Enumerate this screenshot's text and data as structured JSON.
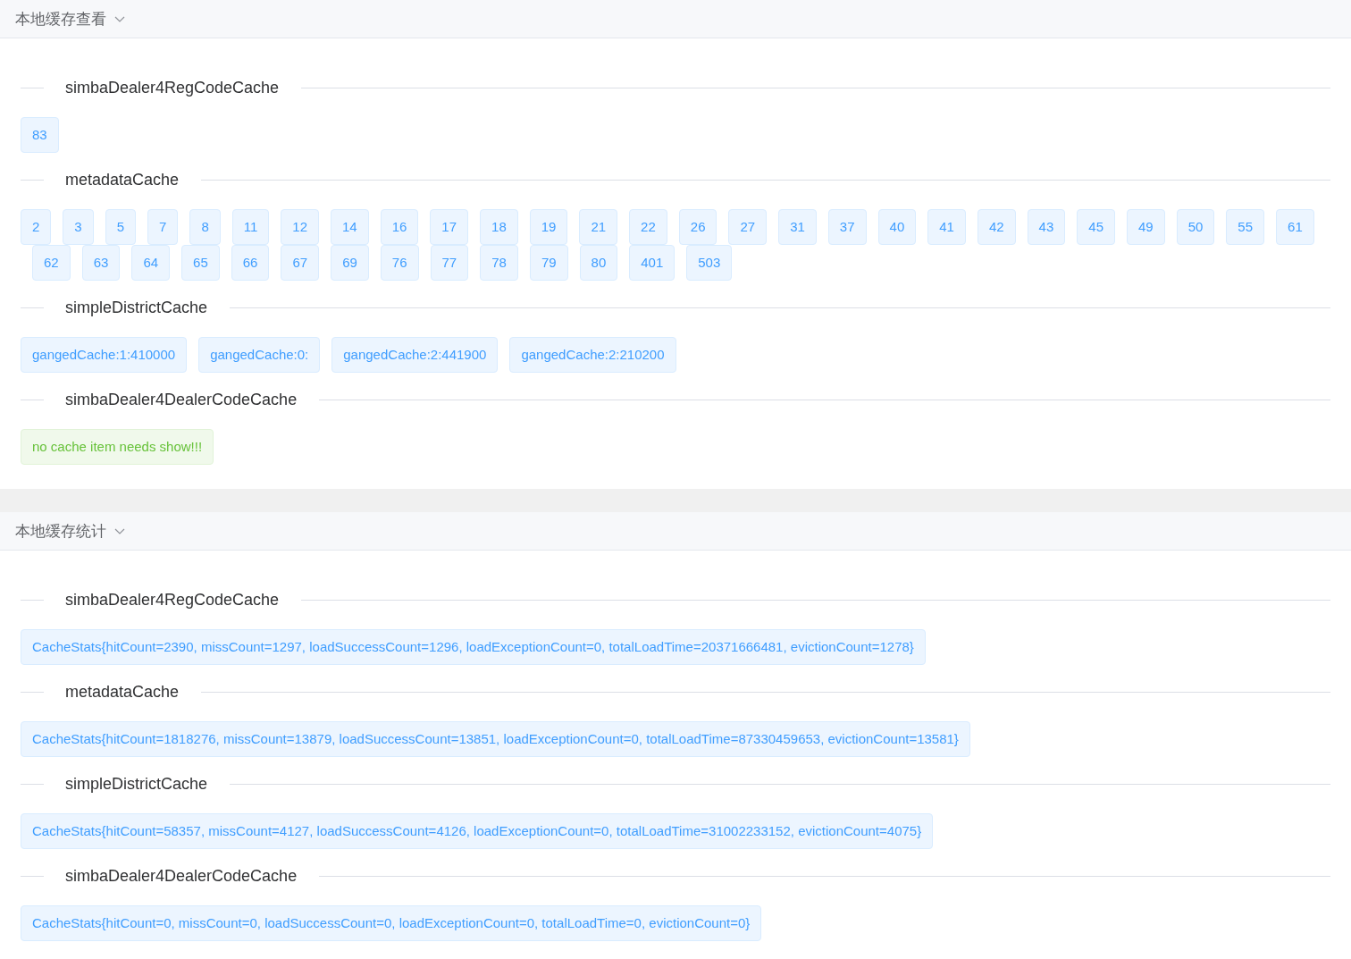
{
  "panels": [
    {
      "title": "本地缓存查看",
      "expanded": true,
      "sections": [
        {
          "name": "simbaDealer4RegCodeCache",
          "tags": [
            {
              "kind": "info",
              "text": "83"
            }
          ]
        },
        {
          "name": "metadataCache",
          "tags": [
            {
              "kind": "info",
              "text": "2"
            },
            {
              "kind": "info",
              "text": "3"
            },
            {
              "kind": "info",
              "text": "5"
            },
            {
              "kind": "info",
              "text": "7"
            },
            {
              "kind": "info",
              "text": "8"
            },
            {
              "kind": "info",
              "text": "11"
            },
            {
              "kind": "info",
              "text": "12"
            },
            {
              "kind": "info",
              "text": "14"
            },
            {
              "kind": "info",
              "text": "16"
            },
            {
              "kind": "info",
              "text": "17"
            },
            {
              "kind": "info",
              "text": "18"
            },
            {
              "kind": "info",
              "text": "19"
            },
            {
              "kind": "info",
              "text": "21"
            },
            {
              "kind": "info",
              "text": "22"
            },
            {
              "kind": "info",
              "text": "26"
            },
            {
              "kind": "info",
              "text": "27"
            },
            {
              "kind": "info",
              "text": "31"
            },
            {
              "kind": "info",
              "text": "37"
            },
            {
              "kind": "info",
              "text": "40"
            },
            {
              "kind": "info",
              "text": "41"
            },
            {
              "kind": "info",
              "text": "42"
            },
            {
              "kind": "info",
              "text": "43"
            },
            {
              "kind": "info",
              "text": "45"
            },
            {
              "kind": "info",
              "text": "49"
            },
            {
              "kind": "info",
              "text": "50"
            },
            {
              "kind": "info",
              "text": "55"
            },
            {
              "kind": "info",
              "text": "61"
            },
            {
              "kind": "info",
              "text": "62"
            },
            {
              "kind": "info",
              "text": "63"
            },
            {
              "kind": "info",
              "text": "64"
            },
            {
              "kind": "info",
              "text": "65"
            },
            {
              "kind": "info",
              "text": "66"
            },
            {
              "kind": "info",
              "text": "67"
            },
            {
              "kind": "info",
              "text": "69"
            },
            {
              "kind": "info",
              "text": "76"
            },
            {
              "kind": "info",
              "text": "77"
            },
            {
              "kind": "info",
              "text": "78"
            },
            {
              "kind": "info",
              "text": "79"
            },
            {
              "kind": "info",
              "text": "80"
            },
            {
              "kind": "info",
              "text": "401"
            },
            {
              "kind": "info",
              "text": "503"
            }
          ]
        },
        {
          "name": "simpleDistrictCache",
          "tags": [
            {
              "kind": "info",
              "text": "gangedCache:1:410000"
            },
            {
              "kind": "info",
              "text": "gangedCache:0:"
            },
            {
              "kind": "info",
              "text": "gangedCache:2:441900"
            },
            {
              "kind": "info",
              "text": "gangedCache:2:210200"
            }
          ]
        },
        {
          "name": "simbaDealer4DealerCodeCache",
          "tags": [
            {
              "kind": "success",
              "text": "no cache item needs show!!!"
            }
          ]
        }
      ]
    },
    {
      "title": "本地缓存统计",
      "expanded": true,
      "sections": [
        {
          "name": "simbaDealer4RegCodeCache",
          "tags": [
            {
              "kind": "info",
              "text": "CacheStats{hitCount=2390, missCount=1297, loadSuccessCount=1296, loadExceptionCount=0, totalLoadTime=20371666481, evictionCount=1278}"
            }
          ]
        },
        {
          "name": "metadataCache",
          "tags": [
            {
              "kind": "info",
              "text": "CacheStats{hitCount=1818276, missCount=13879, loadSuccessCount=13851, loadExceptionCount=0, totalLoadTime=87330459653, evictionCount=13581}"
            }
          ]
        },
        {
          "name": "simpleDistrictCache",
          "tags": [
            {
              "kind": "info",
              "text": "CacheStats{hitCount=58357, missCount=4127, loadSuccessCount=4126, loadExceptionCount=0, totalLoadTime=31002233152, evictionCount=4075}"
            }
          ]
        },
        {
          "name": "simbaDealer4DealerCodeCache",
          "tags": [
            {
              "kind": "info",
              "text": "CacheStats{hitCount=0, missCount=0, loadSuccessCount=0, loadExceptionCount=0, totalLoadTime=0, evictionCount=0}"
            }
          ]
        }
      ]
    }
  ]
}
